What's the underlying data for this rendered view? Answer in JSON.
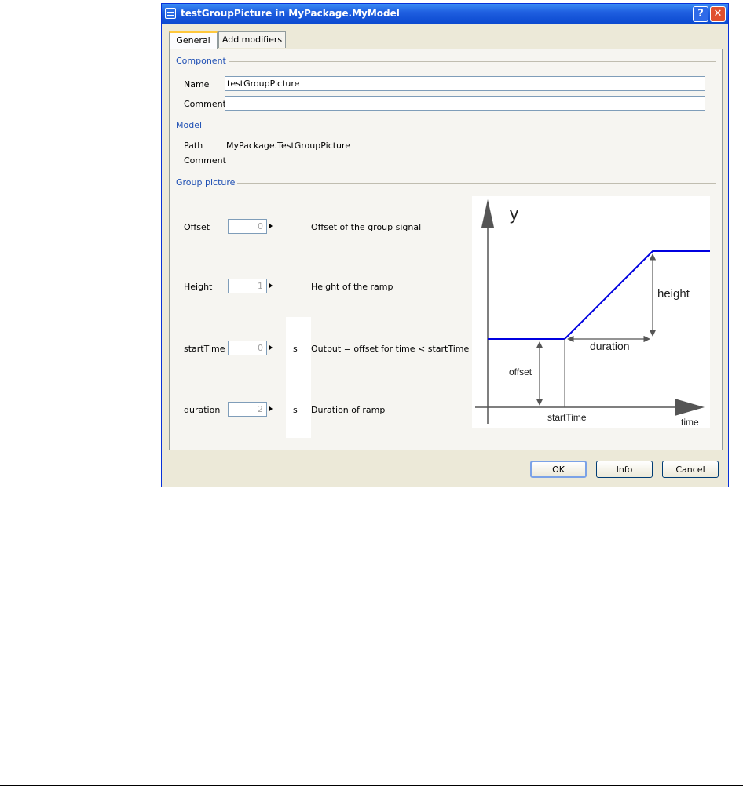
{
  "window": {
    "title": "testGroupPicture in MyPackage.MyModel",
    "help_glyph": "?",
    "close_glyph": "✕",
    "app_icon": "list-window-icon"
  },
  "tabs": [
    {
      "label": "General",
      "active": true
    },
    {
      "label": "Add modifiers",
      "active": false
    }
  ],
  "component": {
    "heading": "Component",
    "name_label": "Name",
    "name_value": "testGroupPicture",
    "comment_label": "Comment",
    "comment_value": ""
  },
  "model": {
    "heading": "Model",
    "path_label": "Path",
    "path_value": "MyPackage.TestGroupPicture",
    "comment_label": "Comment",
    "comment_value": ""
  },
  "group_picture": {
    "heading": "Group picture",
    "params": [
      {
        "label": "Offset",
        "value": "0",
        "unit": "",
        "description": "Offset of the group signal"
      },
      {
        "label": "Height",
        "value": "1",
        "unit": "",
        "description": "Height of the ramp"
      },
      {
        "label": "startTime",
        "value": "0",
        "unit": "s",
        "description": "Output = offset for time < startTime"
      },
      {
        "label": "duration",
        "value": "2",
        "unit": "s",
        "description": "Duration of ramp"
      }
    ]
  },
  "diagram": {
    "y_label": "y",
    "x_label": "time",
    "height_label": "height",
    "duration_label": "duration",
    "offset_label": "offset",
    "start_label": "startTime",
    "signal_color": "#0000e0"
  },
  "buttons": {
    "ok": "OK",
    "info": "Info",
    "cancel": "Cancel"
  }
}
